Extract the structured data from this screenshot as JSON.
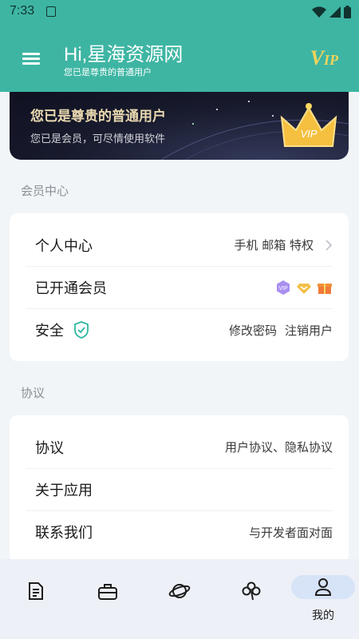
{
  "status": {
    "time": "7:33"
  },
  "header": {
    "title": "Hi,星海资源网",
    "subtitle": "您已是尊贵的普通用户",
    "vip_main": "V",
    "vip_sub": "IP"
  },
  "banner": {
    "title": "您已是尊贵的普通用户",
    "desc": "您已是会员，可尽情使用软件",
    "crown_text": "VIP"
  },
  "member_section": {
    "label": "会员中心",
    "rows": [
      {
        "label": "个人中心",
        "value": "手机 邮箱 特权"
      },
      {
        "label": "已开通会员"
      },
      {
        "label": "安全",
        "value1": "修改密码",
        "value2": "注销用户"
      }
    ]
  },
  "agreement_section": {
    "label": "协议",
    "rows": [
      {
        "label": "协议",
        "value": "用户协议、隐私协议"
      },
      {
        "label": "关于应用"
      },
      {
        "label": "联系我们",
        "value": "与开发者面对面"
      }
    ]
  },
  "nav": {
    "items": [
      {
        "icon": "document-icon"
      },
      {
        "icon": "toolbox-icon"
      },
      {
        "icon": "planet-icon"
      },
      {
        "icon": "clover-icon"
      },
      {
        "icon": "person-icon",
        "label": "我的"
      }
    ]
  },
  "colors": {
    "primary": "#3eb5a3",
    "gold": "#f1d35b",
    "nav_active": "#d7e3f7"
  }
}
